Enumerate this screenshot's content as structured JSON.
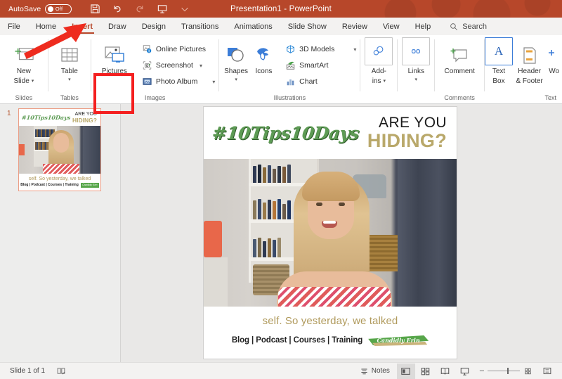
{
  "titlebar": {
    "autosave_label": "AutoSave",
    "autosave_state": "Off",
    "document_title": "Presentation1  -  PowerPoint",
    "quick_access": [
      {
        "name": "save-icon",
        "label": "Save"
      },
      {
        "name": "undo-icon",
        "label": "Undo"
      },
      {
        "name": "redo-icon",
        "label": "Redo"
      },
      {
        "name": "start-presentation-icon",
        "label": "Start From Beginning"
      },
      {
        "name": "customize-qat-icon",
        "label": "Customize Quick Access Toolbar"
      }
    ],
    "accent_color": "#b7472a"
  },
  "tabs": [
    {
      "label": "File",
      "active": false
    },
    {
      "label": "Home",
      "active": false
    },
    {
      "label": "Insert",
      "active": true
    },
    {
      "label": "Draw",
      "active": false
    },
    {
      "label": "Design",
      "active": false
    },
    {
      "label": "Transitions",
      "active": false
    },
    {
      "label": "Animations",
      "active": false
    },
    {
      "label": "Slide Show",
      "active": false
    },
    {
      "label": "Review",
      "active": false
    },
    {
      "label": "View",
      "active": false
    },
    {
      "label": "Help",
      "active": false
    }
  ],
  "search": {
    "label": "Search",
    "icon": "search-icon"
  },
  "ribbon": {
    "groups": [
      {
        "label": "Slides",
        "buttons": [
          {
            "label_line1": "New",
            "label_line2": "Slide",
            "has_caret": true,
            "icon": "new-slide-icon"
          }
        ]
      },
      {
        "label": "Tables",
        "buttons": [
          {
            "label_line1": "Table",
            "label_line2": "",
            "has_caret": true,
            "icon": "table-icon"
          }
        ]
      },
      {
        "label": "Images",
        "buttons": [
          {
            "label_line1": "Pictures",
            "label_line2": "",
            "has_caret": false,
            "icon": "pictures-icon",
            "highlighted": true
          }
        ],
        "small_buttons": [
          {
            "label": "Online Pictures",
            "icon": "online-pictures-icon",
            "has_caret": false
          },
          {
            "label": "Screenshot",
            "icon": "screenshot-icon",
            "has_caret": true
          },
          {
            "label": "Photo Album",
            "icon": "photo-album-icon",
            "has_caret": true
          }
        ]
      },
      {
        "label": "Illustrations",
        "buttons": [
          {
            "label_line1": "Shapes",
            "label_line2": "",
            "has_caret": true,
            "icon": "shapes-icon"
          },
          {
            "label_line1": "Icons",
            "label_line2": "",
            "has_caret": false,
            "icon": "icons-icon"
          }
        ],
        "small_buttons": [
          {
            "label": "3D Models",
            "icon": "3d-models-icon",
            "has_caret": true
          },
          {
            "label": "SmartArt",
            "icon": "smartart-icon",
            "has_caret": false
          },
          {
            "label": "Chart",
            "icon": "chart-icon",
            "has_caret": false
          }
        ]
      },
      {
        "label": "",
        "buttons": [
          {
            "label_line1": "Add-",
            "label_line2": "ins",
            "has_caret": true,
            "icon": "add-ins-icon",
            "boxed": true
          },
          {
            "label_line1": "Links",
            "label_line2": "",
            "has_caret": true,
            "icon": "links-icon",
            "boxed": true
          }
        ]
      },
      {
        "label": "Comments",
        "buttons": [
          {
            "label_line1": "Comment",
            "label_line2": "",
            "has_caret": false,
            "icon": "comment-icon"
          }
        ]
      },
      {
        "label": "Text",
        "buttons": [
          {
            "label_line1": "Text",
            "label_line2": "Box",
            "has_caret": false,
            "icon": "text-box-icon",
            "boxed": true
          },
          {
            "label_line1": "Header",
            "label_line2": "& Footer",
            "has_caret": false,
            "icon": "header-footer-icon",
            "boxed": true
          },
          {
            "label_line1": "Wo",
            "label_line2": "",
            "has_caret": false,
            "icon": "wordart-icon",
            "clipped": true
          }
        ]
      }
    ],
    "annotation": {
      "arrow_color": "#ee2b1e",
      "highlight_color": "#f41f1f",
      "points_to": "Insert tab / Pictures button"
    }
  },
  "thumbnails": {
    "slides": [
      {
        "number": "1",
        "selected": true
      }
    ]
  },
  "slide": {
    "hashtag": "#10Tips10Days",
    "headline_line1": "ARE YOU",
    "headline_line2": "HIDING?",
    "tagline": "self. So yesterday, we talked",
    "links": "Blog | Podcast | Courses | Training",
    "logo_text": "Candidly Erin",
    "colors": {
      "hashtag_green": "#5d9b54",
      "headline_gold": "#b9a86a",
      "tagline_gold": "#b09a5c",
      "logo_green": "#57a64a"
    }
  },
  "statusbar": {
    "slide_count_text": "Slide 1 of 1",
    "accessibility_icon": "accessibility-checker-icon",
    "notes_label": "Notes",
    "views": [
      {
        "name": "normal-view-button",
        "selected": true
      },
      {
        "name": "slide-sorter-view-button",
        "selected": false
      },
      {
        "name": "reading-view-button",
        "selected": false
      },
      {
        "name": "slide-show-button",
        "selected": false
      }
    ],
    "zoom": {
      "minus": "–",
      "plus": "+",
      "fit_icon": "fit-slide-to-window-icon"
    }
  }
}
